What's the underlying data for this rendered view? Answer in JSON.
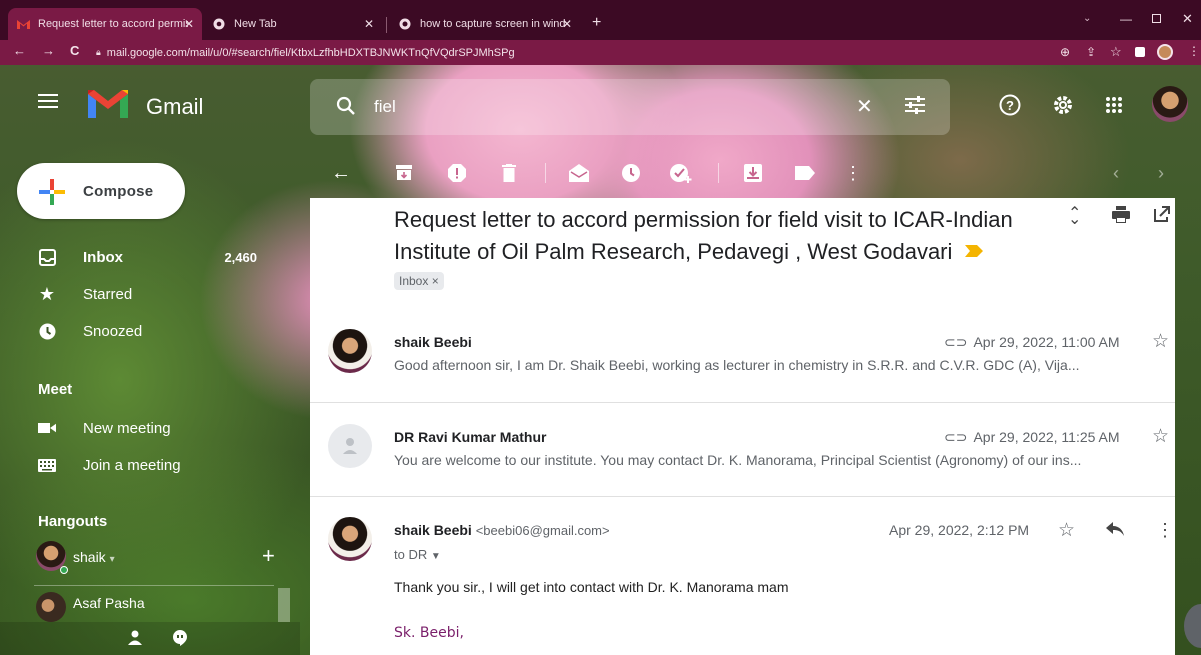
{
  "browser": {
    "tabs": [
      {
        "title": "Request letter to accord permissio",
        "active": true
      },
      {
        "title": "New Tab",
        "active": false
      },
      {
        "title": "how to capture screen in windov",
        "active": false
      }
    ],
    "url": "mail.google.com/mail/u/0/#search/fiel/KtbxLzfhbHDXTBJNWKTnQfVQdrSPJMhSPg"
  },
  "gmail": {
    "logo_text": "Gmail",
    "search_value": "fiel",
    "compose_label": "Compose"
  },
  "sidebar": {
    "items": [
      {
        "label": "Inbox",
        "count": "2,460",
        "icon": "inbox-icon",
        "bold": true
      },
      {
        "label": "Starred",
        "count": "",
        "icon": "star-icon"
      },
      {
        "label": "Snoozed",
        "count": "",
        "icon": "clock-icon"
      }
    ],
    "meet_title": "Meet",
    "meet_items": [
      {
        "label": "New meeting",
        "icon": "video-icon"
      },
      {
        "label": "Join a meeting",
        "icon": "keyboard-icon"
      }
    ],
    "hangouts_title": "Hangouts",
    "hangouts_user": "shaik",
    "hangouts_contacts": [
      {
        "name": "Asaf Pasha"
      }
    ]
  },
  "thread": {
    "subject": "Request letter to accord permission for field visit to ICAR-Indian Institute of Oil Palm Research, Pedavegi , West Godavari",
    "label": "Inbox",
    "messages": [
      {
        "sender": "shaik Beebi",
        "date": "Apr 29, 2022, 11:00 AM",
        "snippet": "Good afternoon sir, I am Dr. Shaik Beebi, working as lecturer in chemistry in S.R.R. and C.V.R. GDC (A), Vija...",
        "has_attachment": true
      },
      {
        "sender": "DR Ravi Kumar Mathur",
        "date": "Apr 29, 2022, 11:25 AM",
        "snippet": "You are welcome to our institute. You may contact Dr. K. Manorama, Principal Scientist (Agronomy) of our ins...",
        "has_attachment": true
      },
      {
        "sender": "shaik Beebi",
        "email": "<beebi06@gmail.com>",
        "date": "Apr 29, 2022, 2:12 PM",
        "to": "to DR",
        "body": "Thank you sir., I will get into contact with Dr. K. Manorama mam",
        "signature": "Sk. Beebi,"
      }
    ]
  }
}
